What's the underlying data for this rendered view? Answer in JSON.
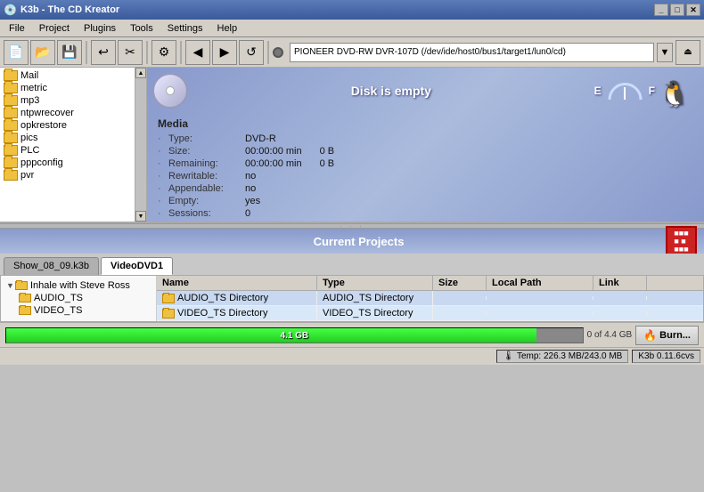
{
  "titlebar": {
    "title": "K3b - The CD Kreator",
    "app_icon": "cd-icon"
  },
  "menubar": {
    "items": [
      "File",
      "Project",
      "Plugins",
      "Tools",
      "Settings",
      "Help"
    ]
  },
  "toolbar": {
    "buttons": [
      "new",
      "open",
      "save",
      "undo",
      "cut",
      "settings",
      "back",
      "forward",
      "refresh",
      "home",
      "search",
      "zoom"
    ],
    "drive_label": "PIONEER DVD-RW  DVR-107D (/dev/ide/host0/bus1/target1/lun0/cd)",
    "drive_icon": "disc-indicator"
  },
  "top_panel": {
    "disk_status": {
      "header": "Disk is empty",
      "gauge_left": "E",
      "gauge_right": "F",
      "media_section_title": "Media",
      "rows": [
        {
          "label": "Type:",
          "value": "DVD-R",
          "value2": ""
        },
        {
          "label": "Size:",
          "value": "00:00:00 min",
          "value2": "0 B"
        },
        {
          "label": "Remaining:",
          "value": "00:00:00 min",
          "value2": "0 B"
        },
        {
          "label": "Rewritable:",
          "value": "no",
          "value2": ""
        },
        {
          "label": "Appendable:",
          "value": "no",
          "value2": ""
        },
        {
          "label": "Empty:",
          "value": "yes",
          "value2": ""
        },
        {
          "label": "Sessions:",
          "value": "0",
          "value2": ""
        }
      ]
    },
    "file_tree": {
      "items": [
        "Mail",
        "metric",
        "mp3",
        "ntpwrecover",
        "opkrestore",
        "pics",
        "PLC",
        "pppconfig",
        "pvr"
      ]
    }
  },
  "bottom_panel": {
    "title": "Current Projects",
    "tabs": [
      {
        "label": "Show_08_09.k3b",
        "active": false
      },
      {
        "label": "VideoDVD1",
        "active": true
      }
    ],
    "project_tree": {
      "root": "Inhale with Steve Ross",
      "children": [
        "AUDIO_TS",
        "VIDEO_TS"
      ]
    },
    "table": {
      "headers": [
        "Name",
        "Type",
        "Size",
        "Local Path",
        "Link"
      ],
      "rows": [
        {
          "name": "AUDIO_TS Directory",
          "type": "AUDIO_TS Directory",
          "size": "",
          "local_path": "",
          "link": "",
          "selected": true
        },
        {
          "name": "VIDEO_TS Directory",
          "type": "VIDEO_TS Directory",
          "size": "",
          "local_path": "",
          "link": "",
          "selected": true
        }
      ]
    },
    "progress": {
      "label": "4.1 GB",
      "fill_pct": 92,
      "extra": "0 of 4.4 GB"
    },
    "burn_button": "Burn..."
  },
  "statusbar": {
    "temp": "Temp: 226.3 MB/243.0 MB",
    "version": "K3b 0.11.6cvs"
  }
}
